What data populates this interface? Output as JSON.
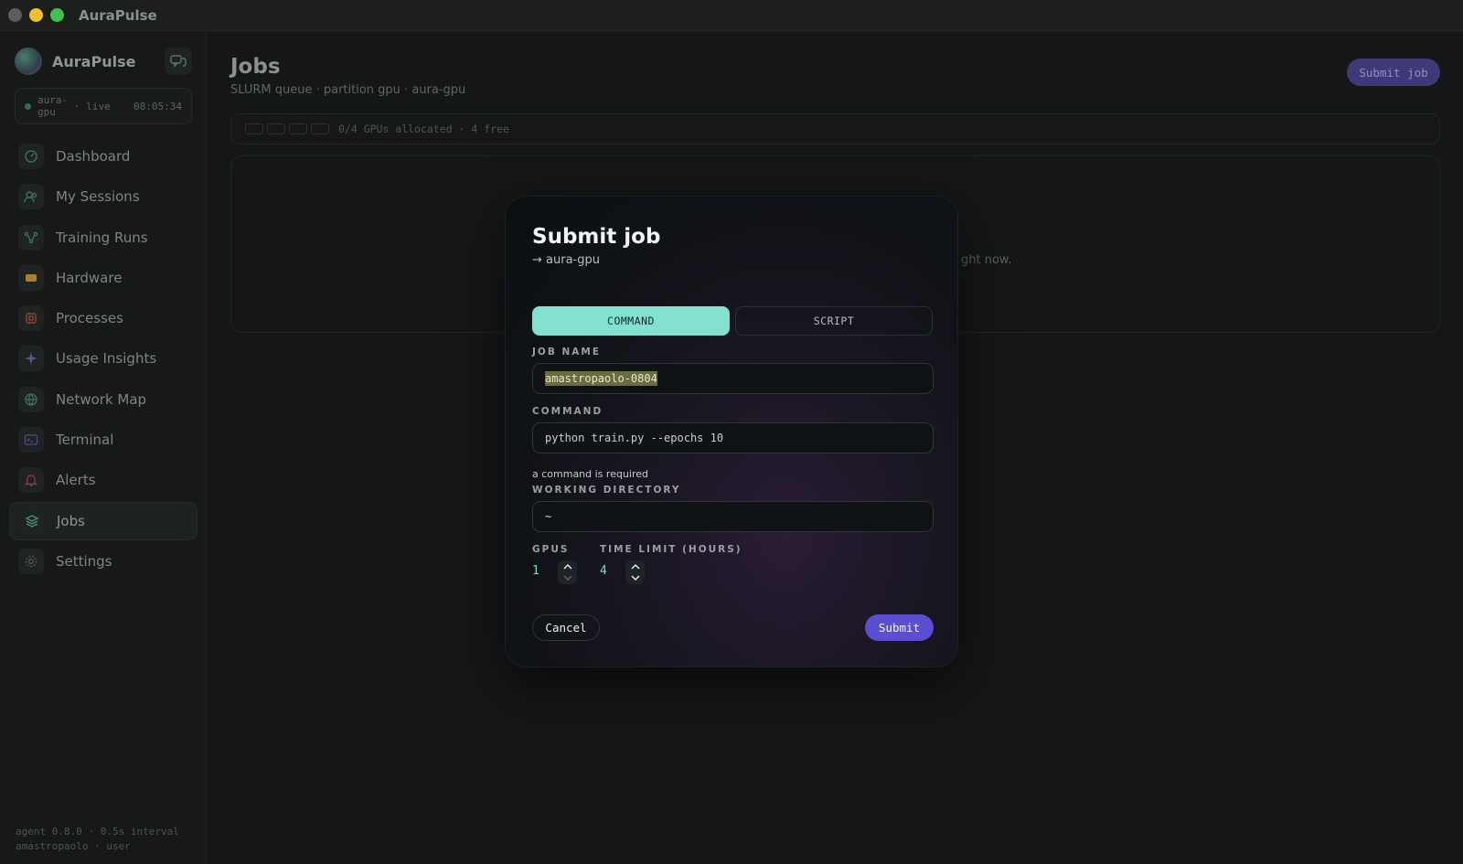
{
  "window": {
    "title": "AuraPulse"
  },
  "sidebar": {
    "brand": "AuraPulse",
    "status": {
      "host": "aura-gpu",
      "state": "· live",
      "time": "08:05:34"
    },
    "items": [
      {
        "label": "Dashboard",
        "icon": "gauge-icon"
      },
      {
        "label": "My Sessions",
        "icon": "users-icon"
      },
      {
        "label": "Training Runs",
        "icon": "graph-icon"
      },
      {
        "label": "Hardware",
        "icon": "chip-icon"
      },
      {
        "label": "Processes",
        "icon": "cpu-icon"
      },
      {
        "label": "Usage Insights",
        "icon": "sparkle-icon"
      },
      {
        "label": "Network Map",
        "icon": "globe-icon"
      },
      {
        "label": "Terminal",
        "icon": "terminal-icon"
      },
      {
        "label": "Alerts",
        "icon": "bell-icon"
      },
      {
        "label": "Jobs",
        "icon": "layers-icon",
        "active": true
      },
      {
        "label": "Settings",
        "icon": "gear-icon"
      }
    ],
    "footer": {
      "line1": "agent 0.8.0 · 0.5s interval",
      "line2": "amastropaolo · user"
    }
  },
  "main": {
    "title": "Jobs",
    "subtitle": "SLURM queue · partition gpu · aura-gpu",
    "submit_label": "Submit job",
    "gpu_summary": "0/4 GPUs allocated · 4 free",
    "empty_fragment": "ght now."
  },
  "modal": {
    "title": "Submit job",
    "target": "→ aura-gpu",
    "tabs": {
      "command": "COMMAND",
      "script": "SCRIPT"
    },
    "job_name_label": "JOB NAME",
    "job_name_value": "amastropaolo-0804",
    "command_label": "COMMAND",
    "command_placeholder": "python train.py --epochs 10",
    "command_error": "a command is required",
    "workdir_label": "WORKING DIRECTORY",
    "workdir_value": "~",
    "gpus_label": "GPUS",
    "gpus_value": "1",
    "time_label": "TIME LIMIT (HOURS)",
    "time_value": "4",
    "cancel_label": "Cancel",
    "submit_label": "Submit"
  },
  "colors": {
    "accent": "#82e2cf",
    "primary_button": "#5b4ed0",
    "background": "#141618"
  }
}
